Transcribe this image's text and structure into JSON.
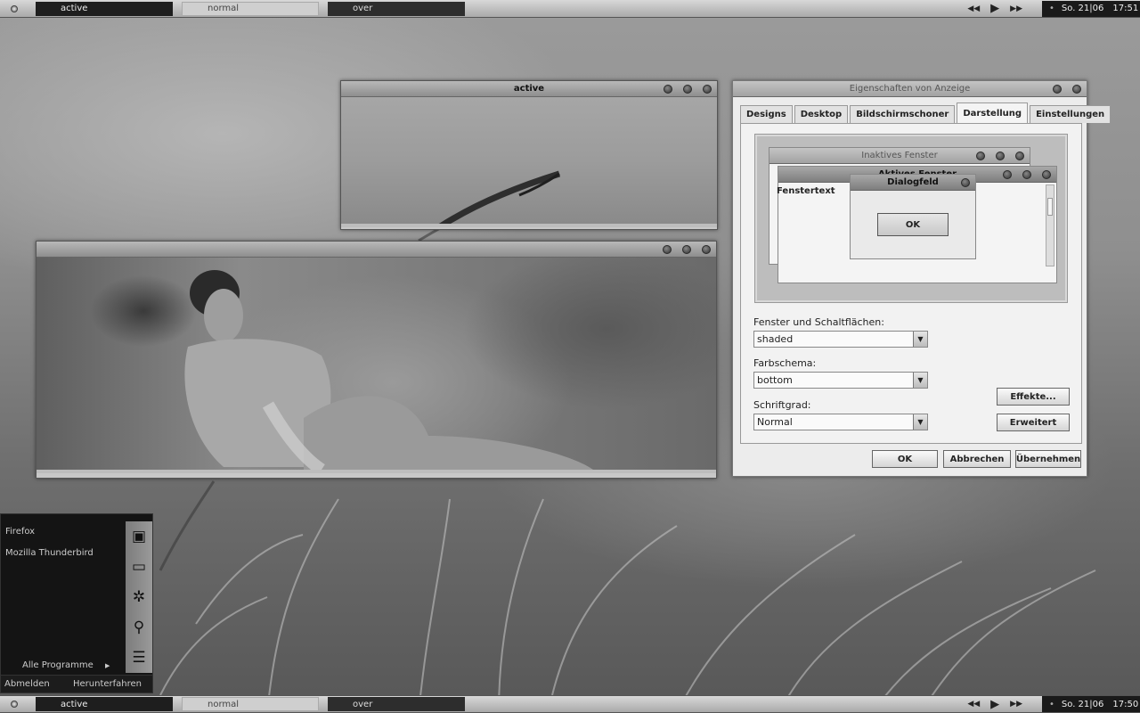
{
  "taskbar_top": {
    "tasks": [
      {
        "label": "active",
        "state": "active"
      },
      {
        "label": "normal",
        "state": "normal"
      },
      {
        "label": "over",
        "state": "over"
      }
    ],
    "clock": {
      "date": "So. 21|06",
      "time": "17:51"
    }
  },
  "taskbar_bottom": {
    "tasks": [
      {
        "label": "active",
        "state": "active"
      },
      {
        "label": "normal",
        "state": "normal"
      },
      {
        "label": "over",
        "state": "over"
      }
    ],
    "clock": {
      "date": "So. 21|06",
      "time": "17:50"
    }
  },
  "active_window": {
    "title": "active"
  },
  "photo_window": {
    "title": ""
  },
  "display_properties": {
    "title": "Eigenschaften von Anzeige",
    "tabs": [
      "Designs",
      "Desktop",
      "Bildschirmschoner",
      "Darstellung",
      "Einstellungen"
    ],
    "selected_tab": "Darstellung",
    "preview": {
      "inactive_title": "Inaktives Fenster",
      "active_title": "Aktives Fenster",
      "window_text": "Fenstertext",
      "dialog_title": "Dialogfeld",
      "dialog_ok": "OK"
    },
    "windows_buttons_label": "Fenster und Schaltflächen:",
    "windows_buttons_value": "shaded",
    "color_scheme_label": "Farbschema:",
    "color_scheme_value": "bottom",
    "font_size_label": "Schriftgrad:",
    "font_size_value": "Normal",
    "effects_button": "Effekte...",
    "advanced_button": "Erweitert",
    "ok_button": "OK",
    "cancel_button": "Abbrechen",
    "apply_button": "Übernehmen"
  },
  "start_menu": {
    "items": [
      "Firefox",
      "Mozilla Thunderbird"
    ],
    "all_programs": "Alle Programme",
    "logoff": "Abmelden",
    "shutdown": "Herunterfahren"
  }
}
